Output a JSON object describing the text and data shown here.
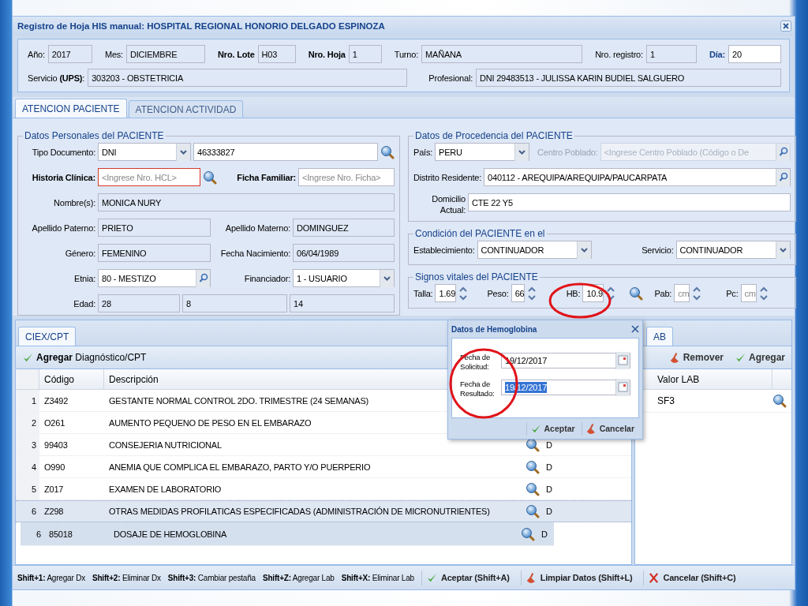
{
  "window": {
    "title": "Registro de Hoja HIS manual: HOSPITAL REGIONAL HONORIO DELGADO ESPINOZA"
  },
  "header": {
    "row_1": [
      {
        "label": "Año:",
        "value": "2017",
        "kind": "readonly"
      },
      {
        "label": "Mes:",
        "value": "DICIEMBRE",
        "kind": "readonly"
      },
      {
        "label": "Nro. Lote",
        "value": "H03",
        "kind": "readonly",
        "bold": true
      },
      {
        "label": "Nro. Hoja",
        "value": "1",
        "kind": "readonly",
        "bold": true
      },
      {
        "label": "Turno:",
        "value": "MAÑANA",
        "kind": "readonly"
      },
      {
        "label": "Nro. registro:",
        "value": "1",
        "kind": "readonly"
      },
      {
        "label": "Día:",
        "value": "20",
        "kind": "input",
        "bold": true,
        "accent": true
      }
    ],
    "row_2": [
      {
        "label": "Servicio **(UPS)**:",
        "value": "303203 - OBSTETRICIA",
        "kind": "readonly"
      },
      {
        "label": "Profesional:",
        "value": "DNI 29483513 - JULISSA KARIN BUDIEL SALGUERO",
        "kind": "readonly"
      }
    ]
  },
  "tabs": [
    {
      "label": "ATENCION PACIENTE",
      "selected": true
    },
    {
      "label": "ATENCION ACTIVIDAD",
      "selected": false
    }
  ],
  "datos_personales": {
    "title": "Datos Personales del PACIENTE",
    "tipo_documento": {
      "label": "Tipo Documento:",
      "value": "DNI",
      "kind": "combo"
    },
    "numero_documento": {
      "value": "46333827",
      "kind": "input"
    },
    "historia_clinica": {
      "label": "Historia Clínica:",
      "placeholder": "<Ingrese Nro. HCL>",
      "kind": "input",
      "bold": true,
      "invalid": true
    },
    "ficha_familiar": {
      "label": "Ficha Familiar:",
      "placeholder": "<Ingrese Nro. Ficha>",
      "kind": "input",
      "bold": true
    },
    "nombres": {
      "label": "Nombre(s):",
      "value": "MONICA NURY",
      "kind": "readonly"
    },
    "apellido_paterno": {
      "label": "Apellido Paterno:",
      "value": "PRIETO",
      "kind": "readonly"
    },
    "apellido_materno": {
      "label": "Apellido Materno:",
      "value": "DOMINGUEZ",
      "kind": "readonly"
    },
    "genero": {
      "label": "Género:",
      "value": "FEMENINO",
      "kind": "readonly"
    },
    "fecha_nacimiento": {
      "label": "Fecha Nacimiento:",
      "value": "06/04/1989",
      "kind": "readonly"
    },
    "etnia": {
      "label": "Etnia:",
      "value": "80 - MESTIZO",
      "kind": "lookup"
    },
    "financiador": {
      "label": "Financiador:",
      "value": "1 - USUARIO",
      "kind": "combo"
    },
    "edad": {
      "label": "Edad:",
      "values": [
        "28",
        "8",
        "14"
      ]
    }
  },
  "datos_procedencia": {
    "title": "Datos de Procedencia del PACIENTE",
    "pais": {
      "label": "País:",
      "value": "PERU",
      "kind": "combo"
    },
    "centro_poblado": {
      "label": "Centro Poblado:",
      "placeholder": "<Ingrese Centro Poblado (Código o De",
      "kind": "lookup",
      "disabled": true
    },
    "distrito_residente": {
      "label": "Distrito Residente:",
      "value": "040112 - AREQUIPA/AREQUIPA/PAUCARPATA",
      "kind": "lookup"
    },
    "domicilio_actual": {
      "label": "Domicilio Actual:",
      "value": "CTE 22 Y5",
      "kind": "input"
    }
  },
  "condicion": {
    "title": "Condición del PACIENTE en el",
    "establecimiento": {
      "label": "Establecimiento:",
      "value": "CONTINUADOR",
      "kind": "combo"
    },
    "servicio": {
      "label": "Servicio:",
      "value": "CONTINUADOR",
      "kind": "combo"
    }
  },
  "signos_vitales": {
    "title": "Signos vitales del PACIENTE",
    "fields": [
      {
        "label": "Talla:",
        "value": "1.69",
        "kind": "spinner"
      },
      {
        "label": "Peso:",
        "value": "66",
        "kind": "spinner"
      },
      {
        "label": "HB:",
        "value": "10.9",
        "kind": "spinner",
        "lookup": true
      },
      {
        "label": "Pab:",
        "placeholder": "cm",
        "kind": "spinner"
      },
      {
        "label": "Pc:",
        "placeholder": "cm",
        "kind": "spinner"
      }
    ]
  },
  "diagnosticos": {
    "tab": {
      "label": "CIEX/CPT",
      "selected": true
    },
    "toolbar_button": {
      "label": "**Agregar** Diagnóstico/CPT"
    },
    "columns": [
      "Código",
      "Descripción"
    ],
    "rows": [
      {
        "number": "1",
        "code": "Z3492",
        "description": "GESTANTE NORMAL CONTROL 2DO. TRIMESTRE (24 SEMANAS)",
        "kind": "diagnosis",
        "selected": false
      },
      {
        "number": "2",
        "code": "O261",
        "description": "AUMENTO PEQUENO DE PESO EN EL EMBARAZO",
        "kind": "diagnosis",
        "selected": false
      },
      {
        "number": "3",
        "code": "99403",
        "description": "CONSEJERIA NUTRICIONAL",
        "kind": "diagnosis",
        "selected": false,
        "type": "D"
      },
      {
        "number": "4",
        "code": "O990",
        "description": "ANEMIA QUE COMPLICA EL EMBARAZO, PARTO Y/O PUERPERIO",
        "kind": "diagnosis",
        "selected": false,
        "type": "D"
      },
      {
        "number": "5",
        "code": "Z017",
        "description": "EXAMEN DE LABORATORIO",
        "kind": "diagnosis",
        "selected": false,
        "type": "D"
      },
      {
        "number": "6",
        "code": "Z298",
        "description": "OTRAS MEDIDAS PROFILATICAS ESPECIFICADAS (ADMINISTRACIÓN DE MICRONUTRIENTES)",
        "kind": "diagnosis",
        "selected": true,
        "type": "D"
      },
      {
        "number": "6",
        "code": "85018",
        "description": "DOSAJE DE HEMOGLOBINA",
        "kind": "lab",
        "selected": false,
        "type": "D"
      }
    ]
  },
  "laboratorio": {
    "tab": {
      "label": "AB",
      "selected": true
    },
    "toolbar_buttons": [
      {
        "label": "Remover"
      },
      {
        "label": "Agregar"
      }
    ],
    "columns": [
      "Valor LAB"
    ],
    "rows": [
      {
        "value": "SF3"
      }
    ]
  },
  "footer": {
    "shortcuts": [
      "**Shift+1:** Agregar Dx",
      "**Shift+2:** Eliminar Dx",
      "**Shift+3:** Cambiar pestaña",
      "**Shift+Z:** Agregar Lab",
      "**Shift+X:** Eliminar Lab"
    ],
    "buttons": [
      {
        "label": "Aceptar (Shift+A)"
      },
      {
        "label": "Limpiar Datos (Shift+L)"
      },
      {
        "label": "Cancelar (Shift+C)"
      }
    ]
  },
  "dialog": {
    "title": "Datos de Hemoglobina",
    "fields": [
      {
        "label": "Fecha de Solicitud:",
        "value": "19/12/2017",
        "kind": "date",
        "selected": false
      },
      {
        "label": "Fecha de Resultado:",
        "value": "19/12/2017",
        "kind": "date",
        "selected": true
      }
    ],
    "buttons": [
      {
        "label": "Aceptar"
      },
      {
        "label": "Cancelar"
      }
    ]
  }
}
